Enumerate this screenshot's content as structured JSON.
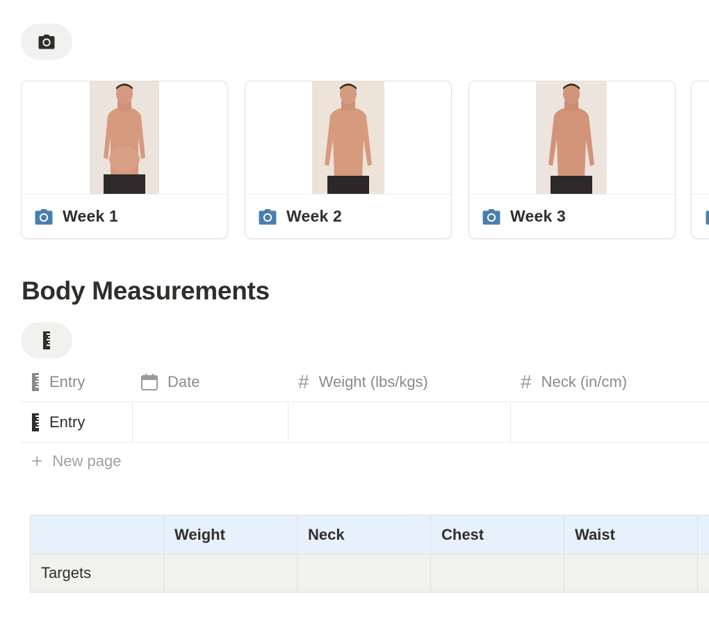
{
  "gallery": {
    "icon": "camera-icon",
    "cards": [
      {
        "title": "Week 1",
        "icon": "camera-icon"
      },
      {
        "title": "Week 2",
        "icon": "camera-icon"
      },
      {
        "title": "Week 3",
        "icon": "camera-icon"
      }
    ]
  },
  "measurements": {
    "heading": "Body Measurements",
    "icon": "ruler-icon",
    "columns": [
      {
        "label": "Entry",
        "icon": "ruler-icon"
      },
      {
        "label": "Date",
        "icon": "calendar-icon"
      },
      {
        "label": "Weight (lbs/kgs)",
        "icon": "hash-icon"
      },
      {
        "label": "Neck (in/cm)",
        "icon": "hash-icon"
      }
    ],
    "rows": [
      {
        "entry": "Entry",
        "date": "",
        "weight": "",
        "neck": ""
      }
    ],
    "new_page_label": "New page"
  },
  "targets_table": {
    "headers": [
      "",
      "Weight",
      "Neck",
      "Chest",
      "Waist",
      ""
    ],
    "rows": [
      [
        "Targets",
        "",
        "",
        "",
        "",
        ""
      ]
    ]
  },
  "colors": {
    "accent_icon": "#4a7fad",
    "header_row_bg": "#e7f1fb",
    "body_row_bg": "#f1f1ef"
  }
}
